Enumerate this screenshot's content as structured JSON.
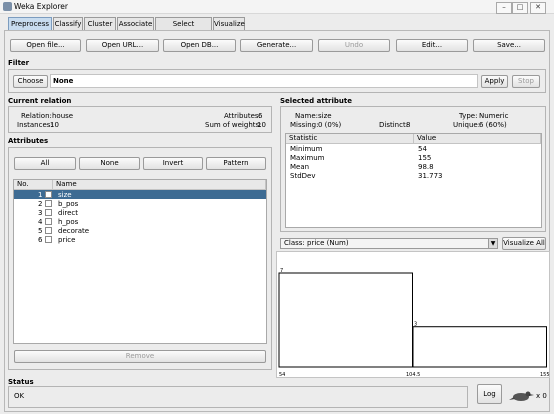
{
  "window": {
    "title": "Weka Explorer"
  },
  "tabs": [
    "Preprocess",
    "Classify",
    "Cluster",
    "Associate",
    "Select attributes",
    "Visualize"
  ],
  "toolbar": {
    "open_file": "Open file...",
    "open_url": "Open URL...",
    "open_db": "Open DB...",
    "generate": "Generate...",
    "undo": "Undo",
    "edit": "Edit...",
    "save": "Save..."
  },
  "filter": {
    "title": "Filter",
    "choose": "Choose",
    "value": "None",
    "apply": "Apply",
    "stop": "Stop"
  },
  "current_relation": {
    "title": "Current relation",
    "relation_label": "Relation:",
    "relation": "house",
    "instances_label": "Instances:",
    "instances": "10",
    "attributes_label": "Attributes:",
    "attributes": "6",
    "sum_weights_label": "Sum of weights:",
    "sum_weights": "10"
  },
  "attributes": {
    "title": "Attributes",
    "buttons": {
      "all": "All",
      "none": "None",
      "invert": "Invert",
      "pattern": "Pattern"
    },
    "col_no": "No.",
    "col_name": "Name",
    "rows": [
      {
        "no": "1",
        "name": "size"
      },
      {
        "no": "2",
        "name": "b_pos"
      },
      {
        "no": "3",
        "name": "direct"
      },
      {
        "no": "4",
        "name": "h_pos"
      },
      {
        "no": "5",
        "name": "decorate"
      },
      {
        "no": "6",
        "name": "price"
      }
    ],
    "remove": "Remove"
  },
  "selected_attribute": {
    "title": "Selected attribute",
    "name_label": "Name:",
    "name": "size",
    "type_label": "Type:",
    "type": "Numeric",
    "missing_label": "Missing:",
    "missing": "0 (0%)",
    "distinct_label": "Distinct:",
    "distinct": "8",
    "unique_label": "Unique:",
    "unique": "6 (60%)",
    "col_statistic": "Statistic",
    "col_value": "Value",
    "stats": [
      {
        "name": "Minimum",
        "value": "54"
      },
      {
        "name": "Maximum",
        "value": "155"
      },
      {
        "name": "Mean",
        "value": "98.8"
      },
      {
        "name": "StdDev",
        "value": "31.773"
      }
    ]
  },
  "class_select": {
    "value": "Class: price (Num)",
    "visualize_all": "Visualize All"
  },
  "chart_data": {
    "type": "bar",
    "categories": [
      "54–104.5",
      "104.5–155"
    ],
    "values": [
      7,
      3
    ],
    "x_tick_labels": [
      "54",
      "104.5",
      "155"
    ],
    "ylim": [
      0,
      7
    ],
    "bar_color": "#000000"
  },
  "status": {
    "title": "Status",
    "text": "OK",
    "log": "Log",
    "count": "x 0"
  }
}
